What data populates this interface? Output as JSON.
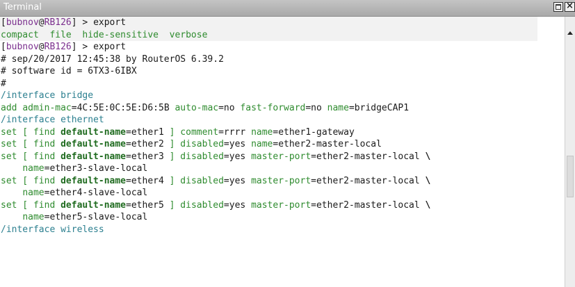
{
  "window": {
    "title": "Terminal"
  },
  "colors": {
    "prompt_bracket": "#1a1a1a",
    "user": "#7b2f8e",
    "host": "#7b2f8e",
    "command": "#1a1a1a",
    "green": "#2e8b2e",
    "teal": "#2b7f8f",
    "keyword": "#1f6b1f",
    "dark": "#1a1a1a"
  },
  "lines": [
    {
      "hl": true,
      "segs": [
        {
          "t": "[",
          "c": "dark"
        },
        {
          "t": "bubnov",
          "c": "user"
        },
        {
          "t": "@",
          "c": "dark"
        },
        {
          "t": "RB126",
          "c": "host"
        },
        {
          "t": "] > export",
          "c": "dark"
        }
      ]
    },
    {
      "hl": true,
      "segs": [
        {
          "t": "compact  file  hide-sensitive  verbose",
          "c": "green"
        }
      ]
    },
    {
      "segs": [
        {
          "t": "[",
          "c": "dark"
        },
        {
          "t": "bubnov",
          "c": "user"
        },
        {
          "t": "@",
          "c": "dark"
        },
        {
          "t": "RB126",
          "c": "host"
        },
        {
          "t": "] > export",
          "c": "dark"
        }
      ]
    },
    {
      "segs": [
        {
          "t": "# sep/20/2017 12:45:38 by RouterOS 6.39.2",
          "c": "dark"
        }
      ]
    },
    {
      "segs": [
        {
          "t": "# software id = 6TX3-6IBX",
          "c": "dark"
        }
      ]
    },
    {
      "segs": [
        {
          "t": "#",
          "c": "dark"
        }
      ]
    },
    {
      "segs": [
        {
          "t": "/interface bridge",
          "c": "teal"
        }
      ]
    },
    {
      "segs": [
        {
          "t": "add ",
          "c": "green"
        },
        {
          "t": "admin-mac",
          "c": "green"
        },
        {
          "t": "=4C:5E:0C:5E:D6:5B ",
          "c": "dark"
        },
        {
          "t": "auto-mac",
          "c": "green"
        },
        {
          "t": "=no ",
          "c": "dark"
        },
        {
          "t": "fast-forward",
          "c": "green"
        },
        {
          "t": "=no ",
          "c": "dark"
        },
        {
          "t": "name",
          "c": "green"
        },
        {
          "t": "=bridgeCAP1",
          "c": "dark"
        }
      ]
    },
    {
      "segs": [
        {
          "t": "/interface ethernet",
          "c": "teal"
        }
      ]
    },
    {
      "segs": [
        {
          "t": "set [ find ",
          "c": "green"
        },
        {
          "t": "default-name",
          "c": "keyword",
          "b": true
        },
        {
          "t": "=ether1 ",
          "c": "dark"
        },
        {
          "t": "] ",
          "c": "green"
        },
        {
          "t": "comment",
          "c": "green"
        },
        {
          "t": "=rrrr ",
          "c": "dark"
        },
        {
          "t": "name",
          "c": "green"
        },
        {
          "t": "=ether1-gateway",
          "c": "dark"
        }
      ]
    },
    {
      "segs": [
        {
          "t": "set [ find ",
          "c": "green"
        },
        {
          "t": "default-name",
          "c": "keyword",
          "b": true
        },
        {
          "t": "=ether2 ",
          "c": "dark"
        },
        {
          "t": "] ",
          "c": "green"
        },
        {
          "t": "disabled",
          "c": "green"
        },
        {
          "t": "=yes ",
          "c": "dark"
        },
        {
          "t": "name",
          "c": "green"
        },
        {
          "t": "=ether2-master-local",
          "c": "dark"
        }
      ]
    },
    {
      "segs": [
        {
          "t": "set [ find ",
          "c": "green"
        },
        {
          "t": "default-name",
          "c": "keyword",
          "b": true
        },
        {
          "t": "=ether3 ",
          "c": "dark"
        },
        {
          "t": "] ",
          "c": "green"
        },
        {
          "t": "disabled",
          "c": "green"
        },
        {
          "t": "=yes ",
          "c": "dark"
        },
        {
          "t": "master-port",
          "c": "green"
        },
        {
          "t": "=ether2-master-local ",
          "c": "dark"
        },
        {
          "t": "\\",
          "c": "dark",
          "b": true
        }
      ]
    },
    {
      "segs": [
        {
          "t": "    ",
          "c": "dark"
        },
        {
          "t": "name",
          "c": "green"
        },
        {
          "t": "=ether3-slave-local",
          "c": "dark"
        }
      ]
    },
    {
      "segs": [
        {
          "t": "set [ find ",
          "c": "green"
        },
        {
          "t": "default-name",
          "c": "keyword",
          "b": true
        },
        {
          "t": "=ether4 ",
          "c": "dark"
        },
        {
          "t": "] ",
          "c": "green"
        },
        {
          "t": "disabled",
          "c": "green"
        },
        {
          "t": "=yes ",
          "c": "dark"
        },
        {
          "t": "master-port",
          "c": "green"
        },
        {
          "t": "=ether2-master-local ",
          "c": "dark"
        },
        {
          "t": "\\",
          "c": "dark",
          "b": true
        }
      ]
    },
    {
      "segs": [
        {
          "t": "    ",
          "c": "dark"
        },
        {
          "t": "name",
          "c": "green"
        },
        {
          "t": "=ether4-slave-local",
          "c": "dark"
        }
      ]
    },
    {
      "segs": [
        {
          "t": "set [ find ",
          "c": "green"
        },
        {
          "t": "default-name",
          "c": "keyword",
          "b": true
        },
        {
          "t": "=ether5 ",
          "c": "dark"
        },
        {
          "t": "] ",
          "c": "green"
        },
        {
          "t": "disabled",
          "c": "green"
        },
        {
          "t": "=yes ",
          "c": "dark"
        },
        {
          "t": "master-port",
          "c": "green"
        },
        {
          "t": "=ether2-master-local ",
          "c": "dark"
        },
        {
          "t": "\\",
          "c": "dark",
          "b": true
        }
      ]
    },
    {
      "segs": [
        {
          "t": "    ",
          "c": "dark"
        },
        {
          "t": "name",
          "c": "green"
        },
        {
          "t": "=ether5-slave-local",
          "c": "dark"
        }
      ]
    },
    {
      "segs": [
        {
          "t": "/interface wireless",
          "c": "teal"
        }
      ]
    }
  ]
}
